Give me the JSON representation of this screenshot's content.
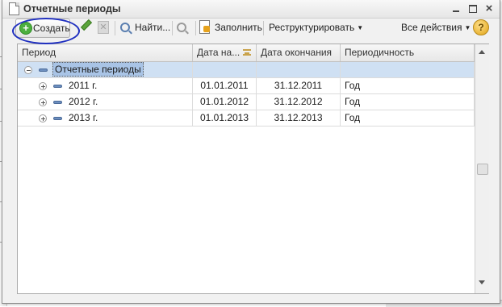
{
  "window": {
    "title": "Отчетные периоды",
    "close_glyph": "×"
  },
  "toolbar": {
    "create_label": "Создать",
    "create_plus": "+",
    "find_label": "Найти...",
    "fill_label": "Заполнить",
    "restructure_label": "Реструктурировать",
    "all_actions_label": "Все действия",
    "caret": "▼",
    "help_label": "?",
    "delete_glyph": "✕",
    "icons": {
      "create": "add-circle-icon",
      "edit": "pencil-icon",
      "delete": "delete-icon",
      "find": "magnifier-icon",
      "cancel_find": "cancel-search-icon",
      "fill": "fill-document-icon",
      "help": "help-icon"
    }
  },
  "table": {
    "columns": [
      "Период",
      "Дата на...",
      "Дата окончания",
      "Периодичность"
    ],
    "sort_column": "Дата на...",
    "root": {
      "label": "Отчетные периоды",
      "expanded": true,
      "selected": true
    },
    "rows": [
      {
        "period": "2011 г.",
        "start": "01.01.2011",
        "end": "31.12.2011",
        "periodicity": "Год"
      },
      {
        "period": "2012 г.",
        "start": "01.01.2012",
        "end": "31.12.2012",
        "periodicity": "Год"
      },
      {
        "period": "2013 г.",
        "start": "01.01.2013",
        "end": "31.12.2013",
        "periodicity": "Год"
      }
    ]
  },
  "colors": {
    "selection": "#cfe0f3",
    "annotation_circle": "#2030c0",
    "create_icon": "#4caf3f"
  }
}
